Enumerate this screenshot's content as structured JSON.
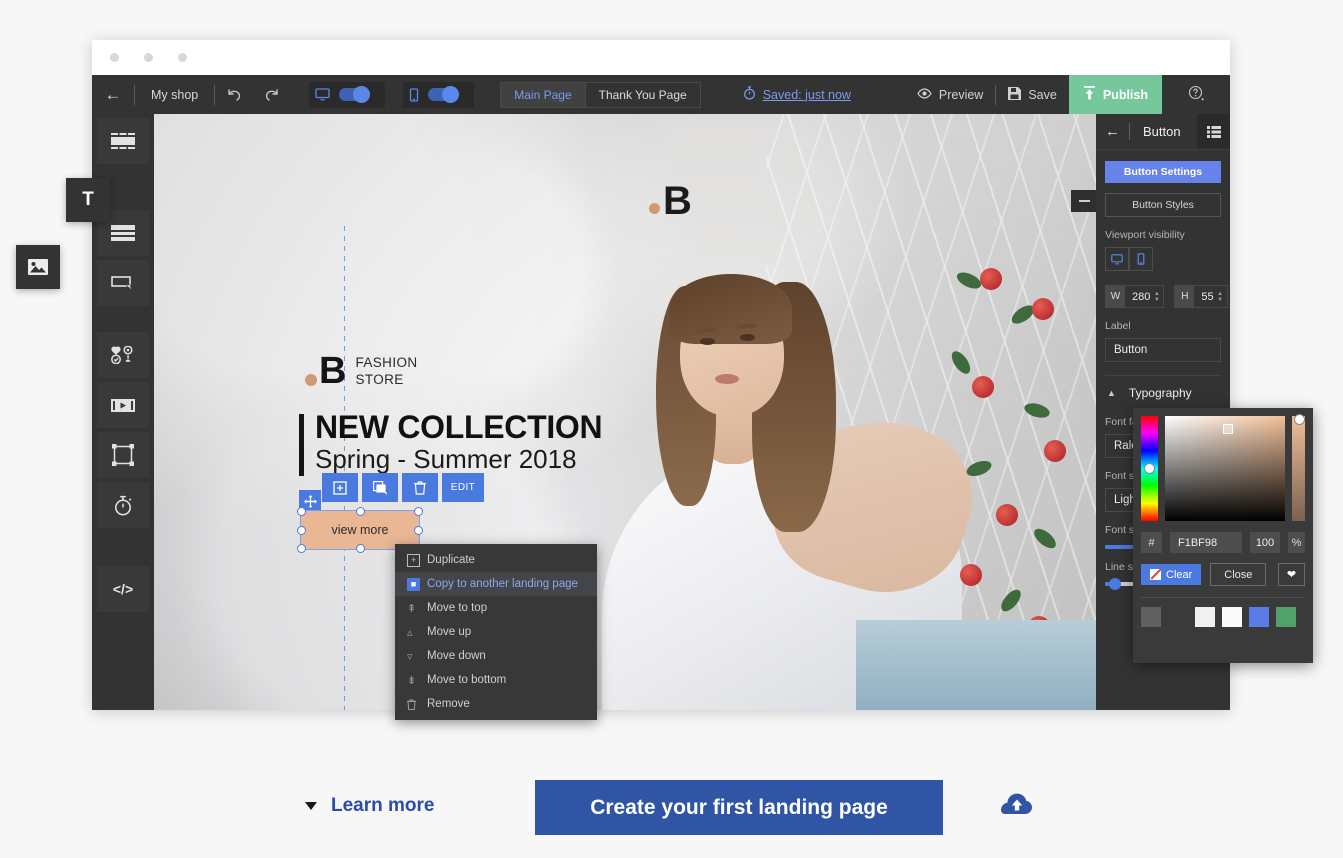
{
  "toolbar": {
    "back_icon": "arrow-left-icon",
    "shop_name": "My shop",
    "undo_icon": "undo-icon",
    "redo_icon": "redo-icon",
    "desktop_icon": "desktop-icon",
    "mobile_icon": "mobile-icon",
    "tabs": [
      {
        "label": "Main Page",
        "active": true
      },
      {
        "label": "Thank You Page",
        "active": false
      }
    ],
    "saved_icon": "stopwatch-icon",
    "saved_text": "Saved: just now",
    "preview_icon": "eye-icon",
    "preview_label": "Preview",
    "save_icon": "floppy-icon",
    "save_label": "Save",
    "publish_icon": "upload-icon",
    "publish_label": "Publish",
    "help_icon": "question-circle-icon"
  },
  "sidebar": {
    "items": [
      {
        "icon": "blocks-icon",
        "name": "blocks"
      },
      {
        "icon": "sections-icon",
        "name": "sections"
      },
      {
        "icon": "button-icon",
        "name": "button"
      },
      {
        "icon": "social-icon",
        "name": "social"
      },
      {
        "icon": "video-icon",
        "name": "video"
      },
      {
        "icon": "frame-icon",
        "name": "frame"
      },
      {
        "icon": "timer-icon",
        "name": "timer"
      },
      {
        "icon": "code-icon",
        "name": "code",
        "label": "</>"
      }
    ],
    "floating": [
      {
        "icon": "text-icon",
        "label": "T",
        "name": "text-tool"
      },
      {
        "icon": "image-icon",
        "name": "image-tool"
      }
    ]
  },
  "canvas": {
    "watermark_letter": "B",
    "brand": {
      "letter": "B",
      "line1": "FASHION",
      "line2": "STORE"
    },
    "headline": "NEW COLLECTION",
    "subheadline": "Spring - Summer 2018",
    "selected_button_label": "view more",
    "selected_button_color": "#EAB794",
    "element_toolbar": [
      {
        "icon": "duplicate-icon",
        "name": "duplicate"
      },
      {
        "icon": "copy-icon",
        "name": "copy"
      },
      {
        "icon": "trash-icon",
        "name": "delete"
      },
      {
        "icon": "edit-icon",
        "label": "EDIT",
        "name": "edit"
      }
    ],
    "move_handle_icon": "move-icon",
    "collapse_icon": "minus-icon"
  },
  "context_menu": {
    "items": [
      {
        "label": "Duplicate",
        "icon": "duplicate-icon",
        "highlighted": false
      },
      {
        "label": "Copy to another landing page",
        "icon": "copy-page-icon",
        "highlighted": true
      },
      {
        "label": "Move to top",
        "icon": "double-chevron-up-icon",
        "highlighted": false
      },
      {
        "label": "Move up",
        "icon": "chevron-up-icon",
        "highlighted": false
      },
      {
        "label": "Move down",
        "icon": "chevron-down-icon",
        "highlighted": false
      },
      {
        "label": "Move to bottom",
        "icon": "double-chevron-down-icon",
        "highlighted": false
      },
      {
        "label": "Remove",
        "icon": "trash-icon",
        "highlighted": false
      }
    ]
  },
  "right_panel": {
    "back_icon": "arrow-left-icon",
    "title": "Button",
    "menu_icon": "list-icon",
    "tab_settings": "Button Settings",
    "tab_styles": "Button Styles",
    "viewport_label": "Viewport visibility",
    "viewport_desktop_icon": "desktop-icon",
    "viewport_mobile_icon": "mobile-icon",
    "width_tag": "W",
    "width_value": "280",
    "height_tag": "H",
    "height_value": "55",
    "label_caption": "Label",
    "label_value": "Button",
    "typography_title": "Typography",
    "typography_caret": "chevron-up-icon",
    "font_family_label": "Font family",
    "font_family_value": "Raleway",
    "font_style_label": "Font style",
    "font_style_value": "Light",
    "font_size_label": "Font size (px)",
    "font_size_pct": 41,
    "line_spacing_label": "Line spacing",
    "line_spacing_pct": 9
  },
  "color_picker": {
    "hash_symbol": "#",
    "hex_value": "F1BF98",
    "opacity_value": "100",
    "percent_symbol": "%",
    "clear_label": "Clear",
    "clear_icon": "no-color-icon",
    "close_label": "Close",
    "favorite_icon": "heart-icon",
    "swatches": [
      "#606060",
      "#3a3a3a",
      "#f0f0f0",
      "#fafafa",
      "#5b7ce6",
      "#52a06b"
    ]
  },
  "cta": {
    "learn_more": "Learn more",
    "learn_more_caret": "caret-down-icon",
    "primary_label": "Create your first landing page",
    "cloud_icon": "cloud-upload-icon",
    "primary_color": "#2F55A4"
  }
}
